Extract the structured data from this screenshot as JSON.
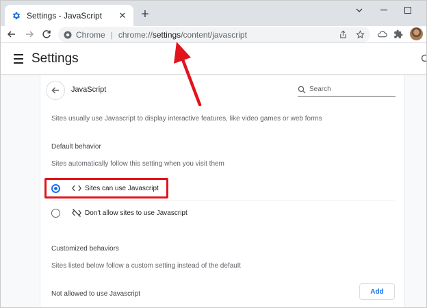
{
  "tab": {
    "title": "Settings - JavaScript",
    "close": "✕",
    "new_tab": "+"
  },
  "window_controls": {
    "minimize": "—",
    "maximize": "☐",
    "dropdown": "⌄"
  },
  "omnibox": {
    "site_label": "Chrome",
    "separator": "|",
    "url_host": "chrome://",
    "url_path": "settings",
    "url_rest": "/content/javascript"
  },
  "header": {
    "title": "Settings"
  },
  "page": {
    "title": "JavaScript",
    "search_placeholder": "Search",
    "description": "Sites usually use Javascript to display interactive features, like video games or web forms",
    "default_behavior": {
      "heading": "Default behavior",
      "subtitle": "Sites automatically follow this setting when you visit them",
      "options": [
        {
          "label": "Sites can use Javascript",
          "selected": true,
          "icon": "code-icon"
        },
        {
          "label": "Don't allow sites to use Javascript",
          "selected": false,
          "icon": "code-off-icon"
        }
      ]
    },
    "customized": {
      "heading": "Customized behaviors",
      "subtitle": "Sites listed below follow a custom setting instead of the default",
      "not_allowed_label": "Not allowed to use Javascript",
      "add_label": "Add"
    }
  },
  "colors": {
    "accent": "#1a73e8",
    "annotation_red": "#e1141c",
    "tabstrip": "#dee1e6"
  }
}
